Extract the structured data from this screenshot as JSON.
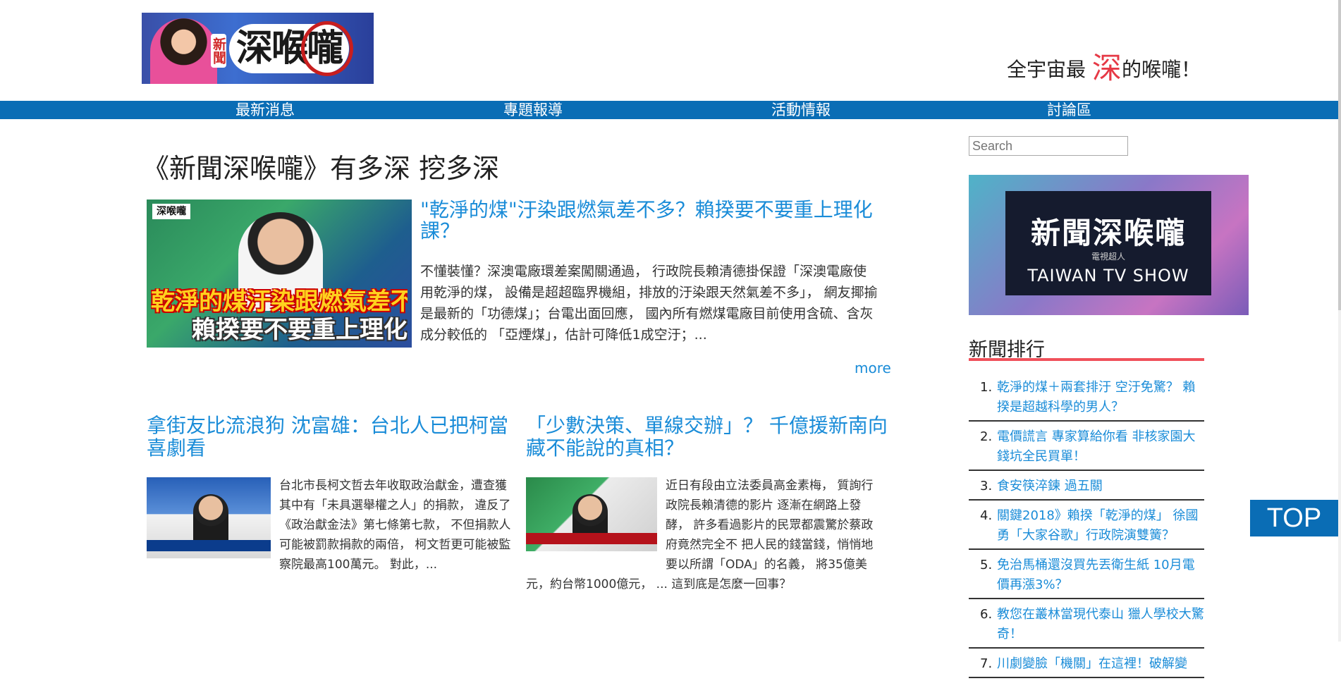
{
  "header": {
    "logo_badge": "新聞",
    "logo_text": "深喉嚨",
    "slogan_before": "全宇宙最",
    "slogan_highlight": "深",
    "slogan_after": "的喉嚨！"
  },
  "nav": {
    "items": [
      {
        "label": "最新消息"
      },
      {
        "label": "專題報導"
      },
      {
        "label": "活動情報"
      },
      {
        "label": "討論區"
      }
    ]
  },
  "main": {
    "page_title": "《新聞深喉嚨》有多深 挖多深",
    "hero": {
      "image_tag": "深喉嚨",
      "image_caption_1": "乾淨的煤汙染跟燃氣差不多？",
      "image_caption_2": "賴揆要不要重上理化課？",
      "title": "\"乾淨的煤\"汙染跟燃氣差不多？賴揆要不要重上理化課？",
      "excerpt": "不懂裝懂？深澳電廠環差案闖關通過， 行政院長賴清德掛保證「深澳電廠使用乾淨的煤， 設備是超超臨界機組，排放的汙染跟天然氣差不多」， 網友揶揄是最新的「功德煤」；台電出面回應， 國內所有燃煤電廠目前使用含硫、含灰成分較低的 「亞煙煤」，估計可降低1成空汙；...",
      "more_label": "more"
    },
    "articles": [
      {
        "title": "拿街友比流浪狗 沈富雄：台北人已把柯當喜劇看",
        "excerpt": "台北市長柯文哲去年收取政治獻金，遭查獲其中有「未具選舉權之人」的捐款， 違反了《政治獻金法》第七條第七款， 不但捐款人可能被罰款捐款的兩倍， 柯文哲更可能被監察院最高100萬元。 對此，..."
      },
      {
        "title": "「少數決策、單線交辦」？ 千億援新南向 藏不能說的真相？",
        "excerpt": "近日有段由立法委員高金素梅， 質詢行政院長賴清德的影片 逐漸在網路上發酵， 許多看過影片的民眾都震驚於蔡政府竟然完全不 把人民的錢當錢，悄悄地要以所謂「ODA」的名義， 將35億美元，約台幣1000億元， ... 這到底是怎麼一回事？"
      }
    ]
  },
  "sidebar": {
    "search_placeholder": "Search",
    "banner_title": "新聞深喉嚨",
    "banner_sub": "電視超人",
    "banner_en": "TAIWAN TV SHOW",
    "ranking_title": "新聞排行",
    "ranking": [
      {
        "num": "1.",
        "text": "乾淨的煤＋兩套排汙 空汙免驚？ 賴揆是超越科學的男人？"
      },
      {
        "num": "2.",
        "text": "電價謊言 專家算給你看 非核家園大錢坑全民買單！"
      },
      {
        "num": "3.",
        "text": "食安筷淬鍊 過五關"
      },
      {
        "num": "4.",
        "text": "關鍵2018》賴揆「乾淨的煤」 徐國勇「大家谷歌」行政院演雙簧？"
      },
      {
        "num": "5.",
        "text": "免治馬桶還沒買先丟衛生紙 10月電價再漲3%？"
      },
      {
        "num": "6.",
        "text": "教您在叢林當現代泰山 獵人學校大驚奇！"
      },
      {
        "num": "7.",
        "text": "川劇變臉「機關」在這裡！破解變"
      }
    ]
  },
  "top_button": "TOP"
}
